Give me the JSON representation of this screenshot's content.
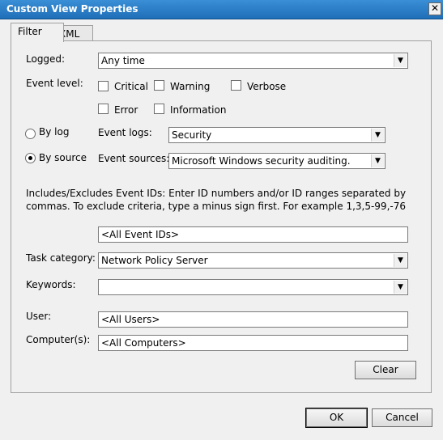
{
  "window": {
    "title": "Custom View Properties",
    "close_glyph": "✕"
  },
  "tabs": [
    {
      "label": "Filter"
    },
    {
      "label": "XML"
    }
  ],
  "filter": {
    "logged": {
      "label": "Logged:",
      "value": "Any time"
    },
    "event_level": {
      "label": "Event level:",
      "critical": "Critical",
      "warning": "Warning",
      "verbose": "Verbose",
      "error": "Error",
      "information": "Information"
    },
    "by_log": {
      "label": "By log",
      "field_label": "Event logs:",
      "value": "Security"
    },
    "by_source": {
      "label": "By source",
      "field_label": "Event sources:",
      "value": "Microsoft Windows security auditing."
    },
    "event_ids": {
      "description": "Includes/Excludes Event IDs: Enter ID numbers and/or ID ranges separated by commas. To exclude criteria, type a minus sign first. For example 1,3,5-99,-76",
      "value": "<All Event IDs>"
    },
    "task_category": {
      "label": "Task category:",
      "value": "Network Policy Server"
    },
    "keywords": {
      "label": "Keywords:",
      "value": ""
    },
    "user": {
      "label": "User:",
      "value": "<All Users>"
    },
    "computer": {
      "label": "Computer(s):",
      "value": "<All Computers>"
    },
    "clear_label": "Clear"
  },
  "footer": {
    "ok_label": "OK",
    "cancel_label": "Cancel"
  },
  "icons": {
    "dropdown": "▼"
  }
}
